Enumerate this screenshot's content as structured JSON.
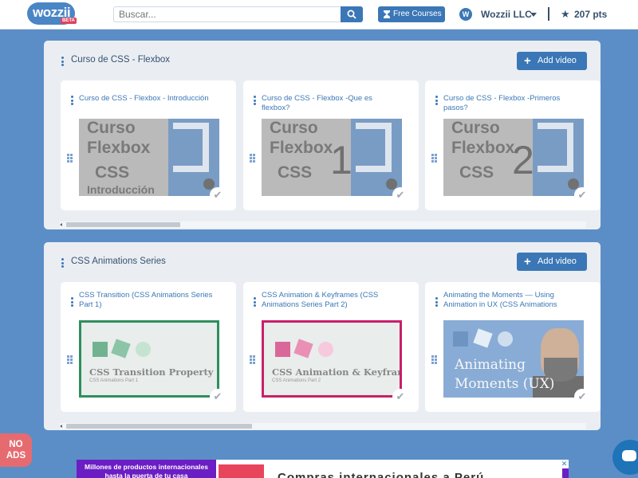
{
  "header": {
    "logo": "wozzii",
    "logo_badge": "BETA",
    "search_placeholder": "Buscar...",
    "free_courses": "Free Courses",
    "company_initial": "W",
    "company": "Wozzii LLC",
    "points": "207 pts"
  },
  "sections": [
    {
      "title": "Curso de CSS - Flexbox",
      "add_label": "Add video",
      "cards": [
        {
          "title": "Curso de CSS - Flexbox - Introducción",
          "thumb_lines": [
            "Curso",
            "Flexbox",
            "CSS",
            "Introducción"
          ],
          "number": ""
        },
        {
          "title": "Curso de CSS - Flexbox -Que es flexbox?",
          "thumb_lines": [
            "Curso",
            "Flexbox",
            "CSS",
            ""
          ],
          "number": "1"
        },
        {
          "title": "Curso de CSS - Flexbox -Primeros pasos?",
          "thumb_lines": [
            "Curso",
            "Flexbox",
            "CSS",
            ""
          ],
          "number": "2"
        }
      ]
    },
    {
      "title": "CSS Animations Series",
      "add_label": "Add video",
      "cards": [
        {
          "title": "CSS Transition (CSS Animations Series Part 1)",
          "thumb_title": "CSS Transition Property",
          "thumb_sub": "CSS Animations Part 1"
        },
        {
          "title": "CSS Animation & Keyframes (CSS Animations Series Part 2)",
          "thumb_title": "CSS Animation & Keyframes",
          "thumb_sub": "CSS Animations Part 2"
        },
        {
          "title": "Animating the Moments — Using Animation in UX (CSS Animations",
          "thumb_lines": [
            "Animating",
            "Moments (UX)"
          ]
        }
      ]
    }
  ],
  "no_ads": [
    "NO",
    "ADS"
  ],
  "ad": {
    "left_text": "Millones de productos internacionales hasta la puerta de tu casa",
    "mid_text": "Compras internacionales a Perú",
    "close": "✕"
  },
  "colors": {
    "accent": "#3b77b6",
    "background": "#5b8ec7",
    "panel": "#eaeef3",
    "no_ads": "#e66b70",
    "ad_purple": "#6b1ec3"
  }
}
